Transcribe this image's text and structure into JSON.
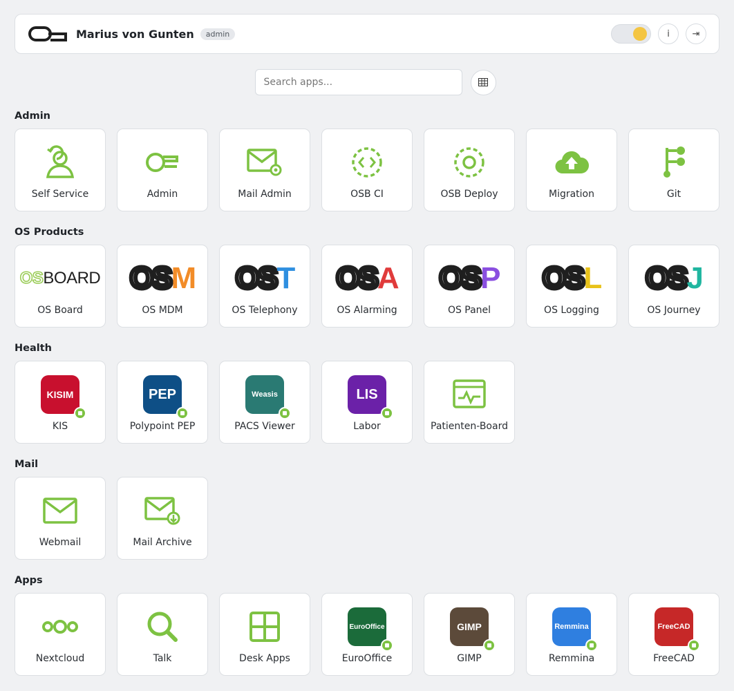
{
  "header": {
    "user_name": "Marius von Gunten",
    "role": "admin",
    "info_label": "i",
    "logout_label": "⇥"
  },
  "search": {
    "placeholder": "Search apps...",
    "view_toggle_glyph": "▦"
  },
  "sections": [
    {
      "title": "Admin",
      "apps": [
        {
          "label": "Self Service",
          "icon": "user-refresh-icon"
        },
        {
          "label": "Admin",
          "icon": "os-admin-icon"
        },
        {
          "label": "Mail Admin",
          "icon": "mail-settings-icon"
        },
        {
          "label": "OSB CI",
          "icon": "code-circle-icon"
        },
        {
          "label": "OSB Deploy",
          "icon": "deploy-circle-icon"
        },
        {
          "label": "Migration",
          "icon": "cloud-upload-icon"
        },
        {
          "label": "Git",
          "icon": "git-branch-icon"
        }
      ]
    },
    {
      "title": "OS Products",
      "apps": [
        {
          "label": "OS Board",
          "logo_prefix": "OS",
          "logo_suffix": "BOARD",
          "accent": "#9ccd5a"
        },
        {
          "label": "OS MDM",
          "logo_prefix": "OS",
          "logo_suffix": "M",
          "accent": "#f28c28"
        },
        {
          "label": "OS Telephony",
          "logo_prefix": "OS",
          "logo_suffix": "T",
          "accent": "#2f8fe0"
        },
        {
          "label": "OS Alarming",
          "logo_prefix": "OS",
          "logo_suffix": "A",
          "accent": "#e03b3b"
        },
        {
          "label": "OS Panel",
          "logo_prefix": "OS",
          "logo_suffix": "P",
          "accent": "#8a4fe0"
        },
        {
          "label": "OS Logging",
          "logo_prefix": "OS",
          "logo_suffix": "L",
          "accent": "#e8c21a"
        },
        {
          "label": "OS Journey",
          "logo_prefix": "OS",
          "logo_suffix": "J",
          "accent": "#20b6a0"
        }
      ]
    },
    {
      "title": "Health",
      "apps": [
        {
          "label": "KIS",
          "badge_text": "KISIM",
          "badge_color": "#c8102e"
        },
        {
          "label": "Polypoint PEP",
          "badge_text": "PEP",
          "badge_color": "#0e4f86"
        },
        {
          "label": "PACS Viewer",
          "badge_text": "Weasis",
          "badge_color": "#2a7a73"
        },
        {
          "label": "Labor",
          "badge_text": "LIS",
          "badge_color": "#6b21a8"
        },
        {
          "label": "Patienten-Board",
          "icon": "monitor-pulse-icon"
        }
      ]
    },
    {
      "title": "Mail",
      "apps": [
        {
          "label": "Webmail",
          "icon": "mail-icon"
        },
        {
          "label": "Mail Archive",
          "icon": "mail-archive-icon"
        }
      ]
    },
    {
      "title": "Apps",
      "apps": [
        {
          "label": "Nextcloud",
          "icon": "nextcloud-icon"
        },
        {
          "label": "Talk",
          "icon": "search-talk-icon"
        },
        {
          "label": "Desk Apps",
          "icon": "grid-apps-icon"
        },
        {
          "label": "EuroOffice",
          "badge_text": "EuroOffice",
          "badge_color": "#1b6b3a"
        },
        {
          "label": "GIMP",
          "badge_text": "GIMP",
          "badge_color": "#5c4a3a"
        },
        {
          "label": "Remmina",
          "badge_text": "Remmina",
          "badge_color": "#2f7fe0"
        },
        {
          "label": "FreeCAD",
          "badge_text": "FreeCAD",
          "badge_color": "#c62828"
        }
      ]
    }
  ],
  "colors": {
    "accent_green": "#7dc242",
    "logo_dark": "#1f1f1f",
    "background": "#f0f1f3"
  }
}
